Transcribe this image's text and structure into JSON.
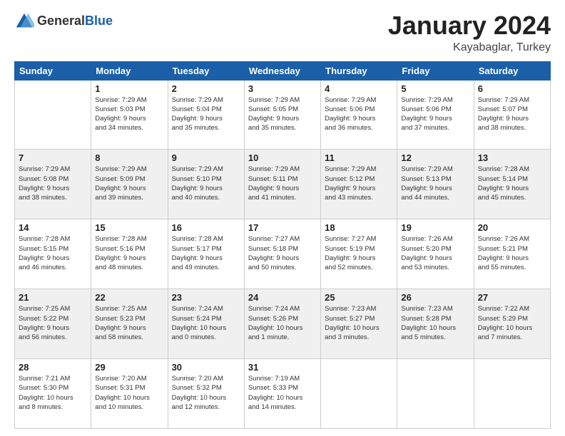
{
  "header": {
    "logo_general": "General",
    "logo_blue": "Blue",
    "month_title": "January 2024",
    "location": "Kayabaglar, Turkey"
  },
  "weekdays": [
    "Sunday",
    "Monday",
    "Tuesday",
    "Wednesday",
    "Thursday",
    "Friday",
    "Saturday"
  ],
  "weeks": [
    [
      {
        "day": "",
        "info": ""
      },
      {
        "day": "1",
        "info": "Sunrise: 7:29 AM\nSunset: 5:03 PM\nDaylight: 9 hours\nand 34 minutes."
      },
      {
        "day": "2",
        "info": "Sunrise: 7:29 AM\nSunset: 5:04 PM\nDaylight: 9 hours\nand 35 minutes."
      },
      {
        "day": "3",
        "info": "Sunrise: 7:29 AM\nSunset: 5:05 PM\nDaylight: 9 hours\nand 35 minutes."
      },
      {
        "day": "4",
        "info": "Sunrise: 7:29 AM\nSunset: 5:06 PM\nDaylight: 9 hours\nand 36 minutes."
      },
      {
        "day": "5",
        "info": "Sunrise: 7:29 AM\nSunset: 5:06 PM\nDaylight: 9 hours\nand 37 minutes."
      },
      {
        "day": "6",
        "info": "Sunrise: 7:29 AM\nSunset: 5:07 PM\nDaylight: 9 hours\nand 38 minutes."
      }
    ],
    [
      {
        "day": "7",
        "info": "Sunrise: 7:29 AM\nSunset: 5:08 PM\nDaylight: 9 hours\nand 38 minutes."
      },
      {
        "day": "8",
        "info": "Sunrise: 7:29 AM\nSunset: 5:09 PM\nDaylight: 9 hours\nand 39 minutes."
      },
      {
        "day": "9",
        "info": "Sunrise: 7:29 AM\nSunset: 5:10 PM\nDaylight: 9 hours\nand 40 minutes."
      },
      {
        "day": "10",
        "info": "Sunrise: 7:29 AM\nSunset: 5:11 PM\nDaylight: 9 hours\nand 41 minutes."
      },
      {
        "day": "11",
        "info": "Sunrise: 7:29 AM\nSunset: 5:12 PM\nDaylight: 9 hours\nand 43 minutes."
      },
      {
        "day": "12",
        "info": "Sunrise: 7:29 AM\nSunset: 5:13 PM\nDaylight: 9 hours\nand 44 minutes."
      },
      {
        "day": "13",
        "info": "Sunrise: 7:28 AM\nSunset: 5:14 PM\nDaylight: 9 hours\nand 45 minutes."
      }
    ],
    [
      {
        "day": "14",
        "info": "Sunrise: 7:28 AM\nSunset: 5:15 PM\nDaylight: 9 hours\nand 46 minutes."
      },
      {
        "day": "15",
        "info": "Sunrise: 7:28 AM\nSunset: 5:16 PM\nDaylight: 9 hours\nand 48 minutes."
      },
      {
        "day": "16",
        "info": "Sunrise: 7:28 AM\nSunset: 5:17 PM\nDaylight: 9 hours\nand 49 minutes."
      },
      {
        "day": "17",
        "info": "Sunrise: 7:27 AM\nSunset: 5:18 PM\nDaylight: 9 hours\nand 50 minutes."
      },
      {
        "day": "18",
        "info": "Sunrise: 7:27 AM\nSunset: 5:19 PM\nDaylight: 9 hours\nand 52 minutes."
      },
      {
        "day": "19",
        "info": "Sunrise: 7:26 AM\nSunset: 5:20 PM\nDaylight: 9 hours\nand 53 minutes."
      },
      {
        "day": "20",
        "info": "Sunrise: 7:26 AM\nSunset: 5:21 PM\nDaylight: 9 hours\nand 55 minutes."
      }
    ],
    [
      {
        "day": "21",
        "info": "Sunrise: 7:25 AM\nSunset: 5:22 PM\nDaylight: 9 hours\nand 56 minutes."
      },
      {
        "day": "22",
        "info": "Sunrise: 7:25 AM\nSunset: 5:23 PM\nDaylight: 9 hours\nand 58 minutes."
      },
      {
        "day": "23",
        "info": "Sunrise: 7:24 AM\nSunset: 5:24 PM\nDaylight: 10 hours\nand 0 minutes."
      },
      {
        "day": "24",
        "info": "Sunrise: 7:24 AM\nSunset: 5:26 PM\nDaylight: 10 hours\nand 1 minute."
      },
      {
        "day": "25",
        "info": "Sunrise: 7:23 AM\nSunset: 5:27 PM\nDaylight: 10 hours\nand 3 minutes."
      },
      {
        "day": "26",
        "info": "Sunrise: 7:23 AM\nSunset: 5:28 PM\nDaylight: 10 hours\nand 5 minutes."
      },
      {
        "day": "27",
        "info": "Sunrise: 7:22 AM\nSunset: 5:29 PM\nDaylight: 10 hours\nand 7 minutes."
      }
    ],
    [
      {
        "day": "28",
        "info": "Sunrise: 7:21 AM\nSunset: 5:30 PM\nDaylight: 10 hours\nand 8 minutes."
      },
      {
        "day": "29",
        "info": "Sunrise: 7:20 AM\nSunset: 5:31 PM\nDaylight: 10 hours\nand 10 minutes."
      },
      {
        "day": "30",
        "info": "Sunrise: 7:20 AM\nSunset: 5:32 PM\nDaylight: 10 hours\nand 12 minutes."
      },
      {
        "day": "31",
        "info": "Sunrise: 7:19 AM\nSunset: 5:33 PM\nDaylight: 10 hours\nand 14 minutes."
      },
      {
        "day": "",
        "info": ""
      },
      {
        "day": "",
        "info": ""
      },
      {
        "day": "",
        "info": ""
      }
    ]
  ]
}
